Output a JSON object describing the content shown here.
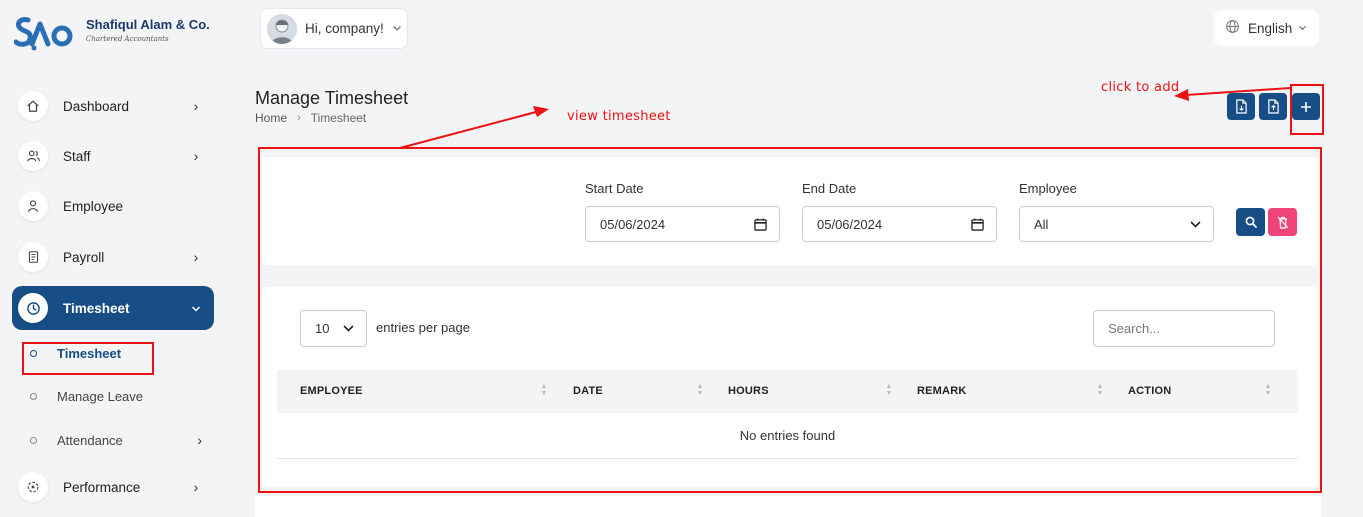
{
  "brand": {
    "name": "Shafiqul Alam & Co.",
    "tagline": "Chartered Accountants"
  },
  "header": {
    "greeting": "Hi, company!",
    "language": "English"
  },
  "sidebar": {
    "items": [
      {
        "label": "Dashboard",
        "icon": "home-icon"
      },
      {
        "label": "Staff",
        "icon": "users-icon"
      },
      {
        "label": "Employee",
        "icon": "user-icon"
      },
      {
        "label": "Payroll",
        "icon": "receipt-icon"
      },
      {
        "label": "Timesheet",
        "icon": "clock-icon"
      },
      {
        "label": "Performance",
        "icon": "performance-icon"
      }
    ],
    "subitems": [
      {
        "label": "Timesheet"
      },
      {
        "label": "Manage Leave"
      },
      {
        "label": "Attendance"
      }
    ]
  },
  "page": {
    "title": "Manage Timesheet",
    "breadcrumb": [
      "Home",
      "Timesheet"
    ]
  },
  "filters": {
    "start_date_label": "Start Date",
    "start_date_value": "05/06/2024",
    "end_date_label": "End Date",
    "end_date_value": "05/06/2024",
    "employee_label": "Employee",
    "employee_value": "All"
  },
  "table": {
    "per_page_value": "10",
    "per_page_label": "entries per page",
    "search_placeholder": "Search...",
    "columns": [
      "EMPLOYEE",
      "DATE",
      "HOURS",
      "REMARK",
      "ACTION"
    ],
    "empty_text": "No entries found"
  },
  "annotations": {
    "view": "view timesheet",
    "add": "click to add"
  },
  "colors": {
    "primary": "#174e86",
    "danger": "#ef4477",
    "annotation": "#e11111"
  }
}
